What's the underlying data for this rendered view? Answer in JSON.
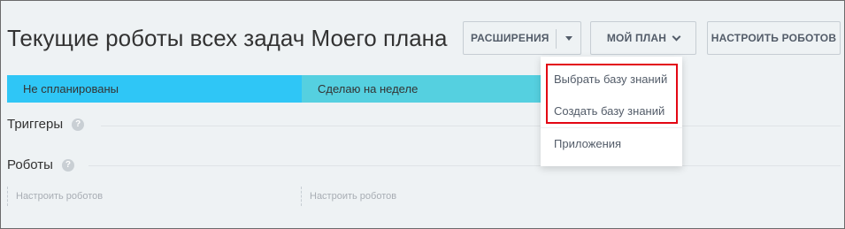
{
  "page": {
    "title": "Текущие роботы всех задач Моего плана"
  },
  "toolbar": {
    "extensions_label": "РАСШИРЕНИЯ",
    "plan_label": "МОЙ ПЛАН",
    "configure_robots_label": "НАСТРОИТЬ РОБОТОВ"
  },
  "stages": [
    {
      "label": "Не спланированы",
      "color": "#2fc6f6"
    },
    {
      "label": "Сделаю на неделе",
      "color": "#55d0e0"
    }
  ],
  "sections": {
    "triggers": "Триггеры",
    "robots": "Роботы",
    "help_glyph": "?"
  },
  "robot_cells": [
    {
      "label": "Настроить роботов"
    },
    {
      "label": "Настроить роботов"
    }
  ],
  "dropdown": {
    "items": [
      {
        "label": "Выбрать базу знаний"
      },
      {
        "label": "Создать базу знаний"
      },
      {
        "label": "Приложения"
      }
    ],
    "highlight_color": "#e30613"
  }
}
